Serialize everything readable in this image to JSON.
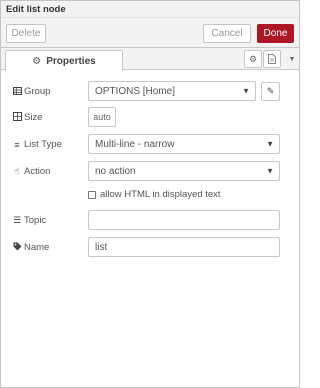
{
  "window": {
    "title": "Edit list node"
  },
  "toolbar": {
    "delete_label": "Delete",
    "cancel_label": "Cancel",
    "done_label": "Done"
  },
  "tabs": [
    {
      "label": "Properties",
      "icon": "gear-icon"
    }
  ],
  "tab_icons": {
    "settings": "gear-icon",
    "description": "document-icon",
    "more": "caret-down-icon"
  },
  "form": {
    "group": {
      "label": "Group",
      "icon": "table-icon",
      "value": "OPTIONS [Home]"
    },
    "size": {
      "label": "Size",
      "icon": "grid-icon",
      "value": "auto"
    },
    "list_type": {
      "label": "List Type",
      "icon": "list-icon",
      "value": "Multi-line - narrow"
    },
    "action": {
      "label": "Action",
      "icon": "pointer-hand-icon",
      "value": "no action"
    },
    "allow_html": {
      "label": "allow HTML in displayed text",
      "checked": false
    },
    "topic": {
      "label": "Topic",
      "icon": "tasks-icon",
      "value": ""
    },
    "name": {
      "label": "Name",
      "icon": "tag-icon",
      "value": "list"
    }
  },
  "colors": {
    "accent": "#ad1625",
    "toolbar_bg": "#f3f3f3",
    "border": "#c8c8c8"
  }
}
